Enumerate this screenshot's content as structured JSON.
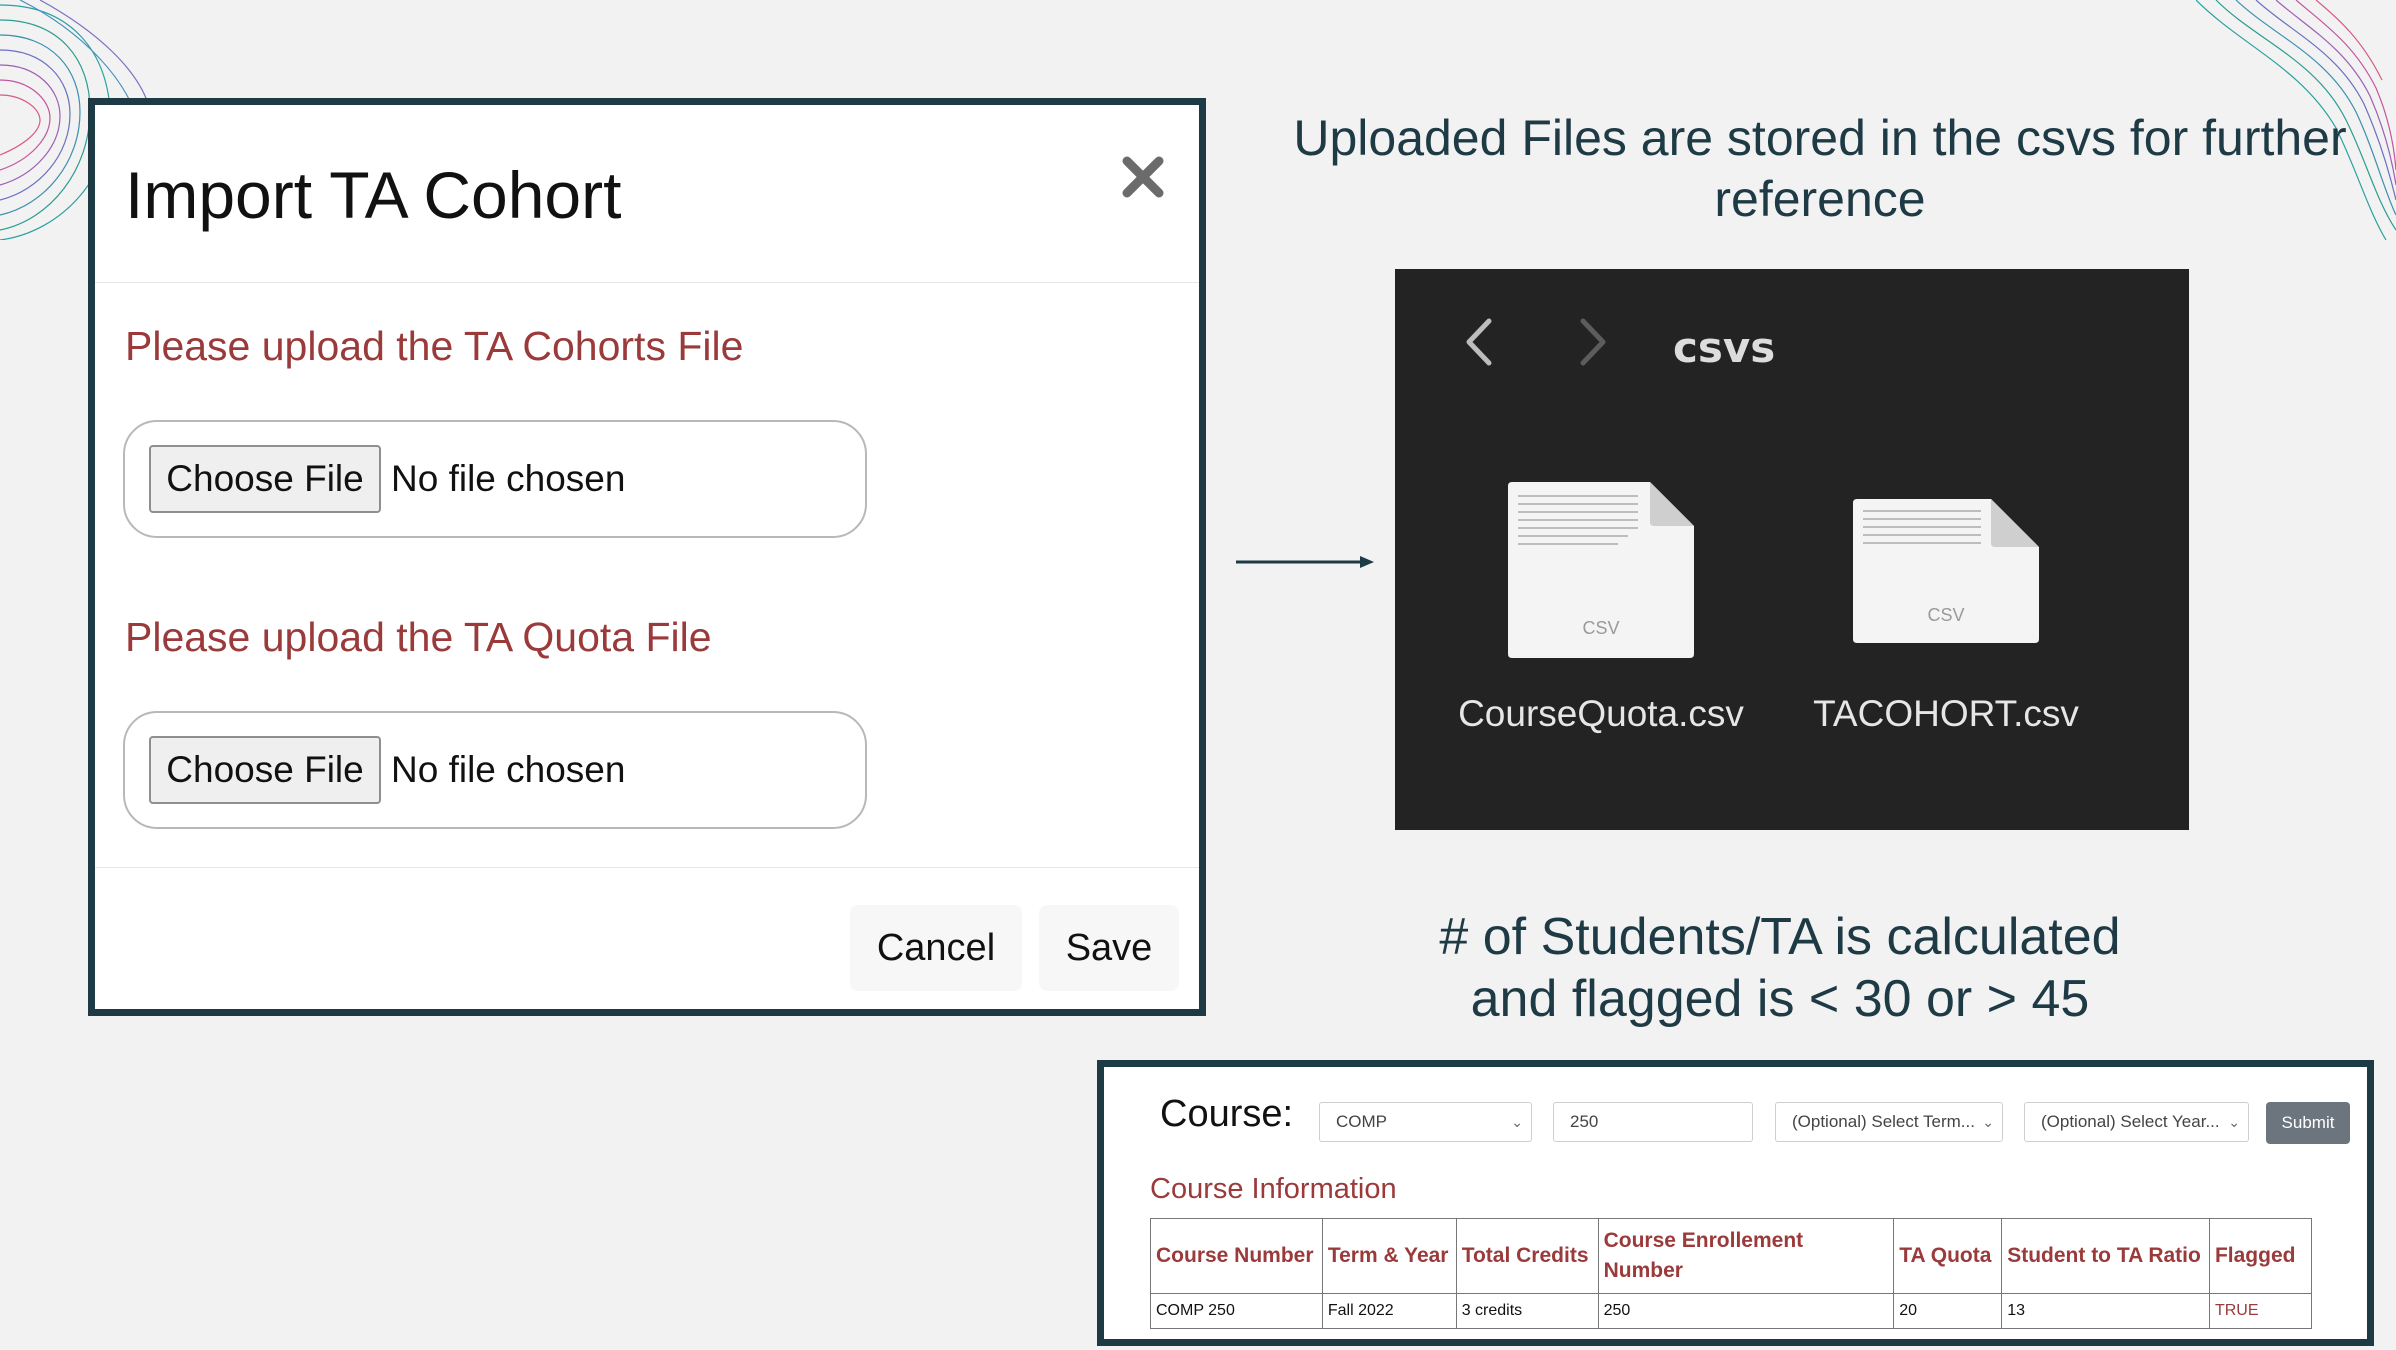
{
  "modal": {
    "title": "Import TA Cohort",
    "close_icon": "close-icon",
    "cohort_label": "Please upload the TA Cohorts File",
    "quota_label": "Please upload the TA Quota File",
    "choose_file_label": "Choose File",
    "no_file_text": "No file chosen",
    "cancel_label": "Cancel",
    "save_label": "Save"
  },
  "stored_text": "Uploaded Files are stored in the csvs for further reference",
  "finder": {
    "folder_name": "csvs",
    "back_icon": "chevron-left-icon",
    "forward_icon": "chevron-right-icon",
    "files": [
      {
        "name": "CourseQuota.csv",
        "badge": "CSV"
      },
      {
        "name": "TACOHORT.csv",
        "badge": "CSV"
      }
    ]
  },
  "calc_text_line1": "# of Students/TA is calculated",
  "calc_text_line2": "and flagged is < 30 or > 45",
  "course_panel": {
    "label": "Course:",
    "subject_select": "COMP",
    "number_input": "250",
    "term_select": "(Optional) Select Term...",
    "year_select": "(Optional) Select Year...",
    "submit_label": "Submit",
    "info_title": "Course Information",
    "columns": [
      "Course Number",
      "Term & Year",
      "Total Credits",
      "Course Enrollement Number",
      "TA Quota",
      "Student to TA Ratio",
      "Flagged"
    ],
    "row": [
      "COMP 250",
      "Fall 2022",
      "3 credits",
      "250",
      "20",
      "13",
      "TRUE"
    ]
  },
  "colors": {
    "accent_red": "#9b3a3a",
    "frame_dark": "#1e3a45",
    "finder_bg": "#232323",
    "submit_gray": "#6c757d"
  }
}
